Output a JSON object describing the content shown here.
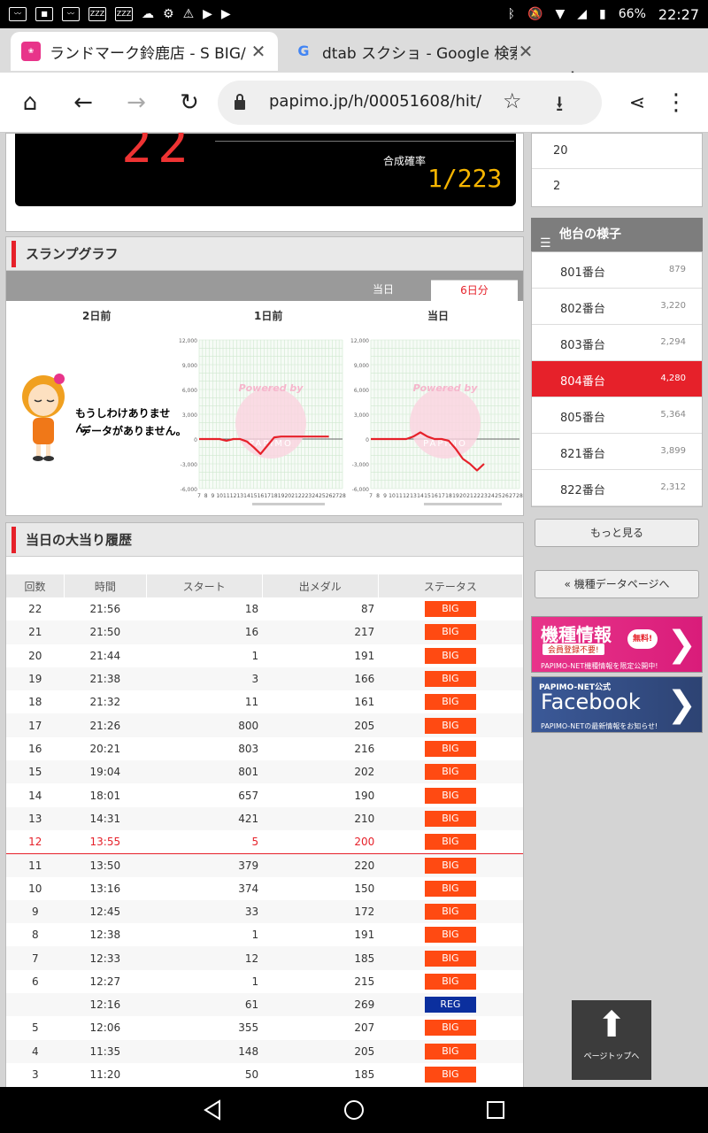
{
  "status_bar": {
    "left_icons": [
      "notification-icon",
      "notification-icon",
      "app-icon",
      "app-icon",
      "app-icon",
      "cloud-icon",
      "settings-icon",
      "warning-icon",
      "youtube-icon",
      "youtube-icon"
    ],
    "app_badge": "ZZZ",
    "battery": "66%",
    "time": "22:27"
  },
  "tabs": [
    {
      "title": "ランドマーク鈴鹿店 - S BIG/",
      "favicon": "papimo",
      "active": true
    },
    {
      "title": "dtab スクショ - Google 検索",
      "favicon": "G",
      "active": false
    }
  ],
  "toolbar": {
    "url": "papimo.jp/h/00051608/hit/"
  },
  "counter": {
    "value": "22",
    "gosei_label": "合成確率",
    "gosei_value": "1/223"
  },
  "slump": {
    "title": "スランプグラフ",
    "tabs": [
      "当日",
      "6日分"
    ],
    "days": [
      "2日前",
      "1日前",
      "当日"
    ],
    "nodata_line1": "もうしわけありません。",
    "nodata_line2": "データがありません。",
    "watermark1": "Powered by",
    "watermark2": "PAPIMO",
    "y_ticks": [
      "12,000",
      "9,000",
      "6,000",
      "3,000",
      "0",
      "-3,000",
      "-6,000"
    ],
    "x_ticks": [
      "7",
      "8",
      "9",
      "10",
      "11",
      "12",
      "13",
      "14",
      "15",
      "16",
      "17",
      "18",
      "19",
      "20",
      "21",
      "22",
      "23",
      "24",
      "25",
      "26",
      "27",
      "28"
    ]
  },
  "chart_data": [
    {
      "type": "line",
      "title": "1日前",
      "x": [
        7,
        8,
        9,
        10,
        11,
        12,
        13,
        14,
        15,
        16,
        17,
        18,
        19,
        20,
        21,
        22,
        23,
        24,
        25,
        26
      ],
      "y": [
        0,
        0,
        0,
        0,
        -200,
        0,
        0,
        -300,
        -1000,
        -1800,
        -800,
        200,
        300,
        300,
        300,
        300,
        300,
        300,
        300,
        300
      ],
      "ylim": [
        -6000,
        12000
      ],
      "xlim": [
        7,
        28
      ]
    },
    {
      "type": "line",
      "title": "当日",
      "x": [
        7,
        8,
        9,
        10,
        11,
        12,
        13,
        14,
        15,
        16,
        17,
        18,
        19,
        20,
        21,
        22,
        23
      ],
      "y": [
        0,
        0,
        0,
        0,
        0,
        0,
        300,
        800,
        300,
        0,
        0,
        -200,
        -1200,
        -2400,
        -3000,
        -3800,
        -3000
      ],
      "ylim": [
        -6000,
        12000
      ],
      "xlim": [
        7,
        28
      ]
    }
  ],
  "history": {
    "title": "当日の大当り履歴",
    "columns": [
      "回数",
      "時間",
      "スタート",
      "出メダル",
      "ステータス"
    ],
    "rows": [
      [
        "22",
        "21:56",
        "18",
        "87",
        "BIG"
      ],
      [
        "21",
        "21:50",
        "16",
        "217",
        "BIG"
      ],
      [
        "20",
        "21:44",
        "1",
        "191",
        "BIG"
      ],
      [
        "19",
        "21:38",
        "3",
        "166",
        "BIG"
      ],
      [
        "18",
        "21:32",
        "11",
        "161",
        "BIG"
      ],
      [
        "17",
        "21:26",
        "800",
        "205",
        "BIG"
      ],
      [
        "16",
        "20:21",
        "803",
        "216",
        "BIG"
      ],
      [
        "15",
        "19:04",
        "801",
        "202",
        "BIG"
      ],
      [
        "14",
        "18:01",
        "657",
        "190",
        "BIG"
      ],
      [
        "13",
        "14:31",
        "421",
        "210",
        "BIG"
      ],
      [
        "12",
        "13:55",
        "5",
        "200",
        "BIG"
      ],
      [
        "11",
        "13:50",
        "379",
        "220",
        "BIG"
      ],
      [
        "10",
        "13:16",
        "374",
        "150",
        "BIG"
      ],
      [
        "9",
        "12:45",
        "33",
        "172",
        "BIG"
      ],
      [
        "8",
        "12:38",
        "1",
        "191",
        "BIG"
      ],
      [
        "7",
        "12:33",
        "12",
        "185",
        "BIG"
      ],
      [
        "6",
        "12:27",
        "1",
        "215",
        "BIG"
      ],
      [
        "",
        "12:16",
        "61",
        "269",
        "REG"
      ],
      [
        "5",
        "12:06",
        "355",
        "207",
        "BIG"
      ],
      [
        "4",
        "11:35",
        "148",
        "205",
        "BIG"
      ],
      [
        "3",
        "11:20",
        "50",
        "185",
        "BIG"
      ]
    ],
    "highlight_row": 10
  },
  "top_list": [
    "20",
    "2"
  ],
  "others": {
    "title": "他台の様子",
    "items": [
      {
        "name": "801番台",
        "value": "879"
      },
      {
        "name": "802番台",
        "value": "3,220"
      },
      {
        "name": "803番台",
        "value": "2,294"
      },
      {
        "name": "804番台",
        "value": "4,280"
      },
      {
        "name": "805番台",
        "value": "5,364"
      },
      {
        "name": "821番台",
        "value": "3,899"
      },
      {
        "name": "822番台",
        "value": "2,312"
      }
    ],
    "selected_index": 3,
    "more": "もっと見る",
    "model_page": "« 機種データページへ"
  },
  "banners": {
    "kishu_title": "機種情報",
    "kishu_sub": "会員登録不要!",
    "kishu_badge": "無料!",
    "kishu_note": "PAPIMO-NET機種情報を限定公開中!",
    "fb_top": "PAPIMO-NET公式",
    "fb_title": "Facebook",
    "fb_note": "PAPIMO-NETの最新情報をお知らせ!"
  },
  "pagetop": "ページトップへ",
  "colors": {
    "accent": "#e6212a",
    "big": "#ff4a12",
    "reg": "#0b2f9e"
  }
}
